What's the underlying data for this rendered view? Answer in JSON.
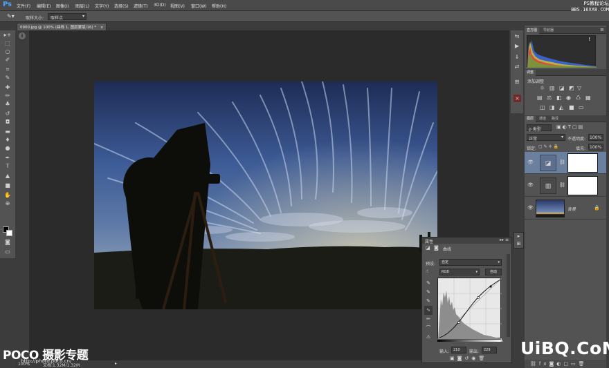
{
  "app": {
    "logo": "Ps"
  },
  "menu": [
    "文件(F)",
    "编辑(E)",
    "图像(I)",
    "图层(L)",
    "文字(Y)",
    "选择(S)",
    "滤镜(T)",
    "3D(D)",
    "视图(V)",
    "窗口(W)",
    "帮助(H)"
  ],
  "watermark_top": {
    "line1": "PS教程论坛",
    "line2": "BBS.16XX8.COM"
  },
  "options_bar": {
    "sample_size_label": "取样大小:",
    "sample_size_value": "取样点"
  },
  "document": {
    "tab_title": "0900.jpg @ 100% (曲线 1, 图层蒙版/16) *",
    "close_label": "×"
  },
  "status": {
    "zoom": "100%",
    "doc_size": "文档:1.32M/1.32M"
  },
  "histogram_panel": {
    "tab_histogram": "直方图",
    "tab_navigator": "导航器",
    "warning": "!"
  },
  "adjustments_panel": {
    "tab": "调整",
    "add_label": "添加调整"
  },
  "layers_panel": {
    "tabs": [
      "图层",
      "通道",
      "路径"
    ],
    "kind_label": "ρ 类型",
    "blend_mode": "正常",
    "opacity_label": "不透明度:",
    "opacity_value": "100%",
    "lock_label": "锁定:",
    "fill_label": "填充:",
    "fill_value": "100%",
    "layers": [
      {
        "name": "",
        "type": "curves",
        "selected": true
      },
      {
        "name": "",
        "type": "levels",
        "selected": false
      },
      {
        "name": "背景",
        "type": "background",
        "selected": false
      }
    ]
  },
  "properties_panel": {
    "title": "属性",
    "adjustment_name": "曲线",
    "preset_label": "预设:",
    "preset_value": "自定",
    "channel_value": "RGB",
    "auto_button": "自动",
    "input_label": "输入:",
    "input_value": "210",
    "output_label": "输出:",
    "output_value": "229"
  },
  "branding": {
    "poco_title": "POCO 摄影专题",
    "poco_url": "http://photo.poco.cn/",
    "uibq": "UiBQ.CoM"
  },
  "colors": {
    "accent": "#4a9fff",
    "panel_bg": "#535353",
    "doc_bg": "#2b2b2b",
    "selected_layer": "#6b7f9e"
  }
}
